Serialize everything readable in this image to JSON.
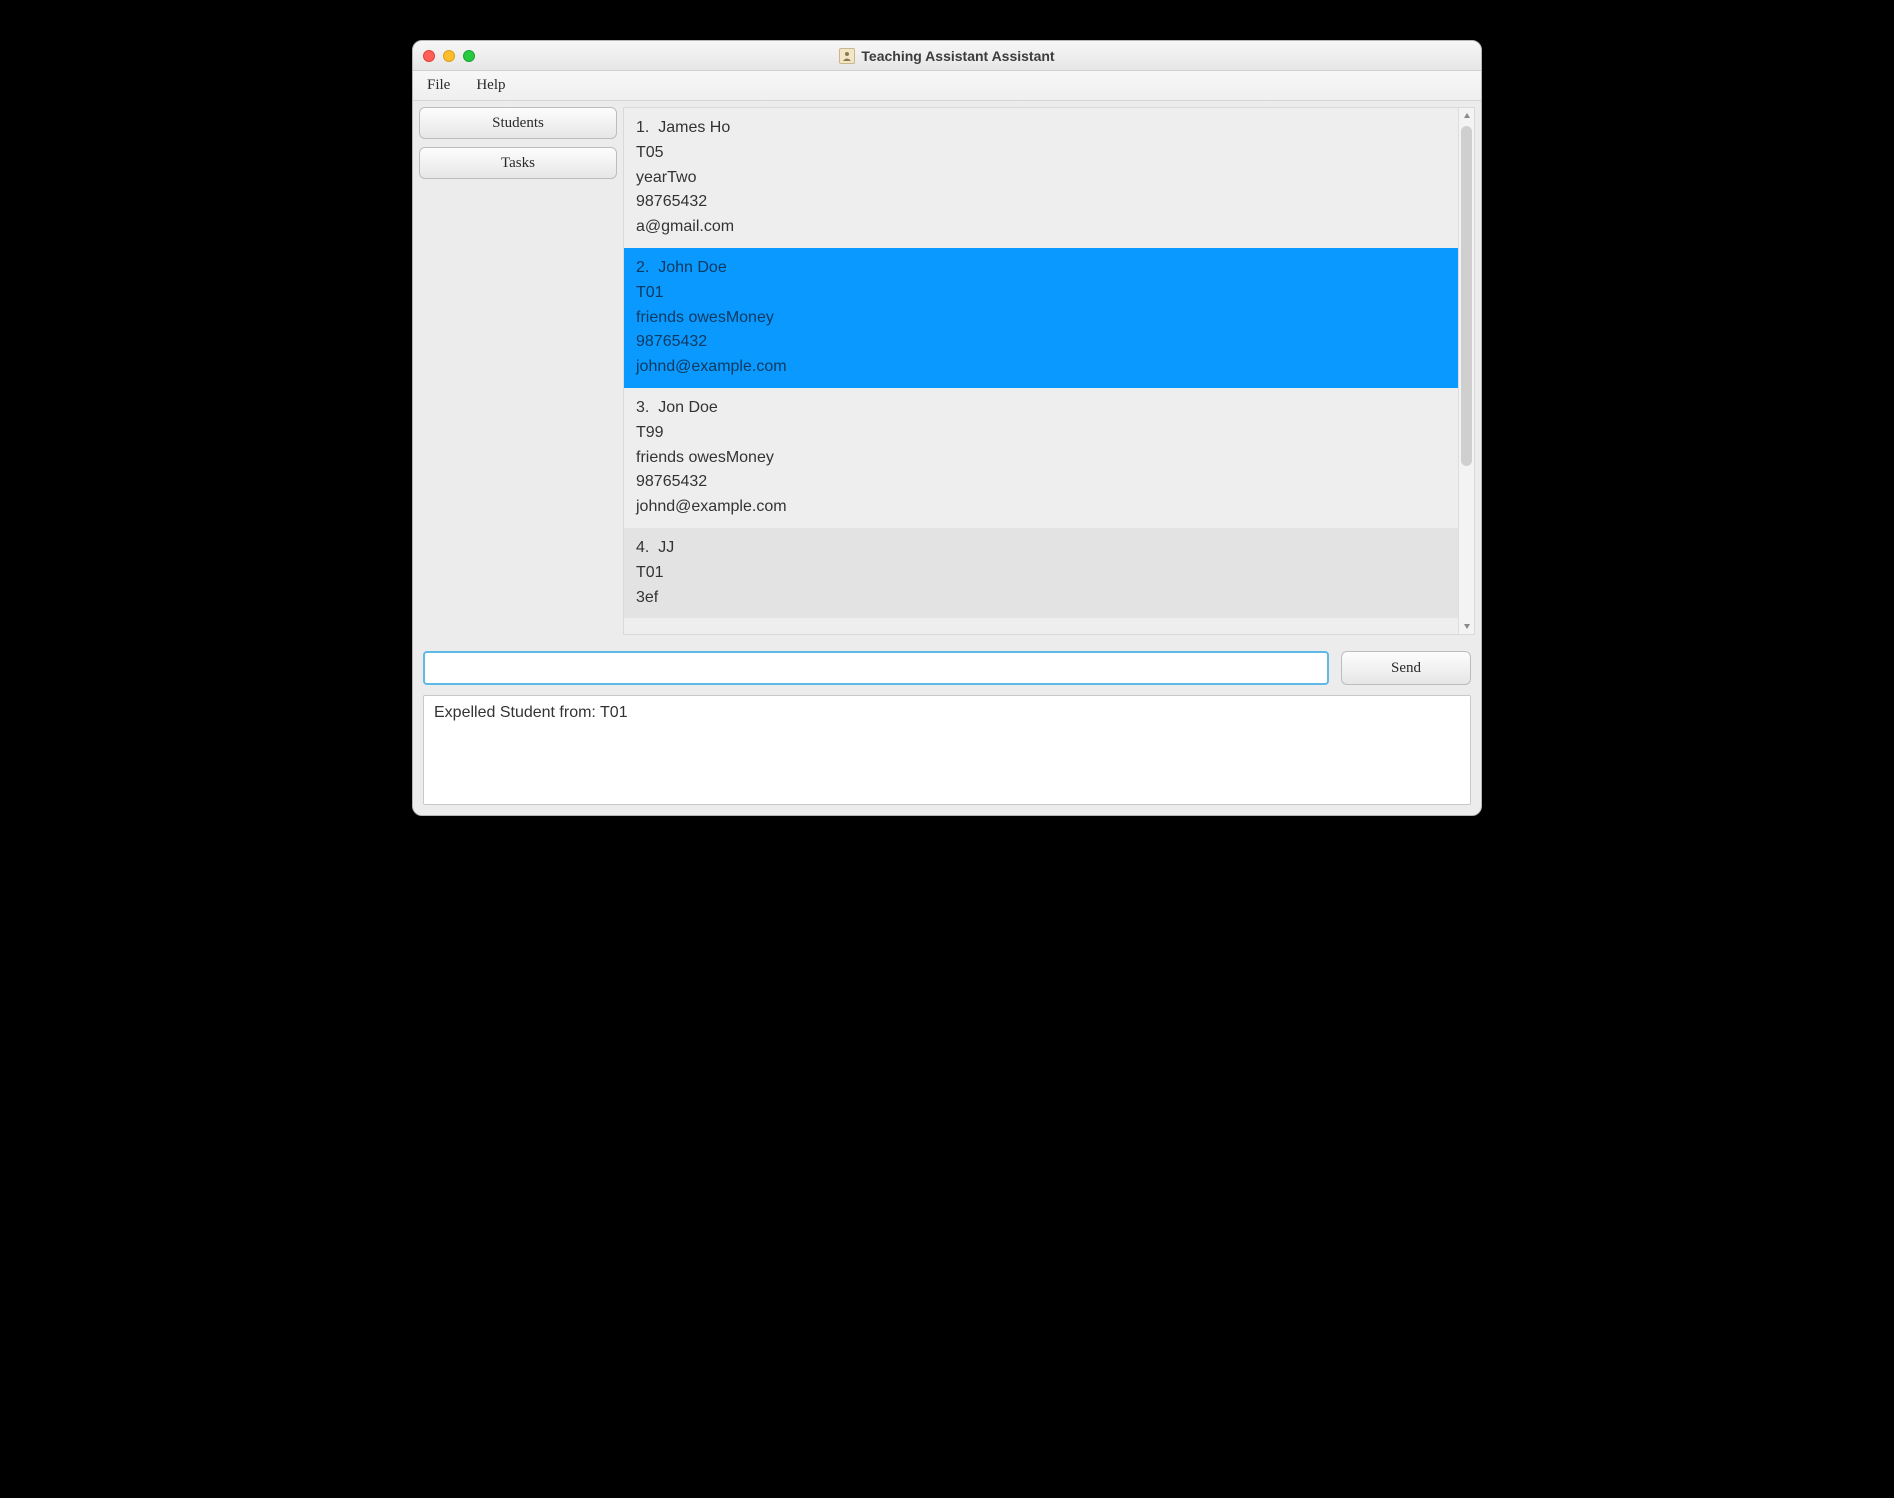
{
  "window": {
    "title": "Teaching Assistant Assistant"
  },
  "menubar": {
    "items": [
      {
        "label": "File"
      },
      {
        "label": "Help"
      }
    ]
  },
  "sidebar": {
    "buttons": [
      {
        "label": "Students"
      },
      {
        "label": "Tasks"
      }
    ]
  },
  "students": [
    {
      "index": "1.",
      "name": "James Ho",
      "group": "T05",
      "tags": "yearTwo",
      "phone": "98765432",
      "email": "a@gmail.com",
      "selected": false
    },
    {
      "index": "2.",
      "name": "John Doe",
      "group": "T01",
      "tags": "friends owesMoney",
      "phone": "98765432",
      "email": "johnd@example.com",
      "selected": true
    },
    {
      "index": "3.",
      "name": "Jon Doe",
      "group": "T99",
      "tags": "friends owesMoney",
      "phone": "98765432",
      "email": "johnd@example.com",
      "selected": false
    },
    {
      "index": "4.",
      "name": "JJ",
      "group": "T01",
      "tags": "3ef",
      "phone": "",
      "email": "",
      "selected": false
    }
  ],
  "command": {
    "value": "",
    "send_label": "Send"
  },
  "output": {
    "text": "Expelled Student from: T01"
  }
}
